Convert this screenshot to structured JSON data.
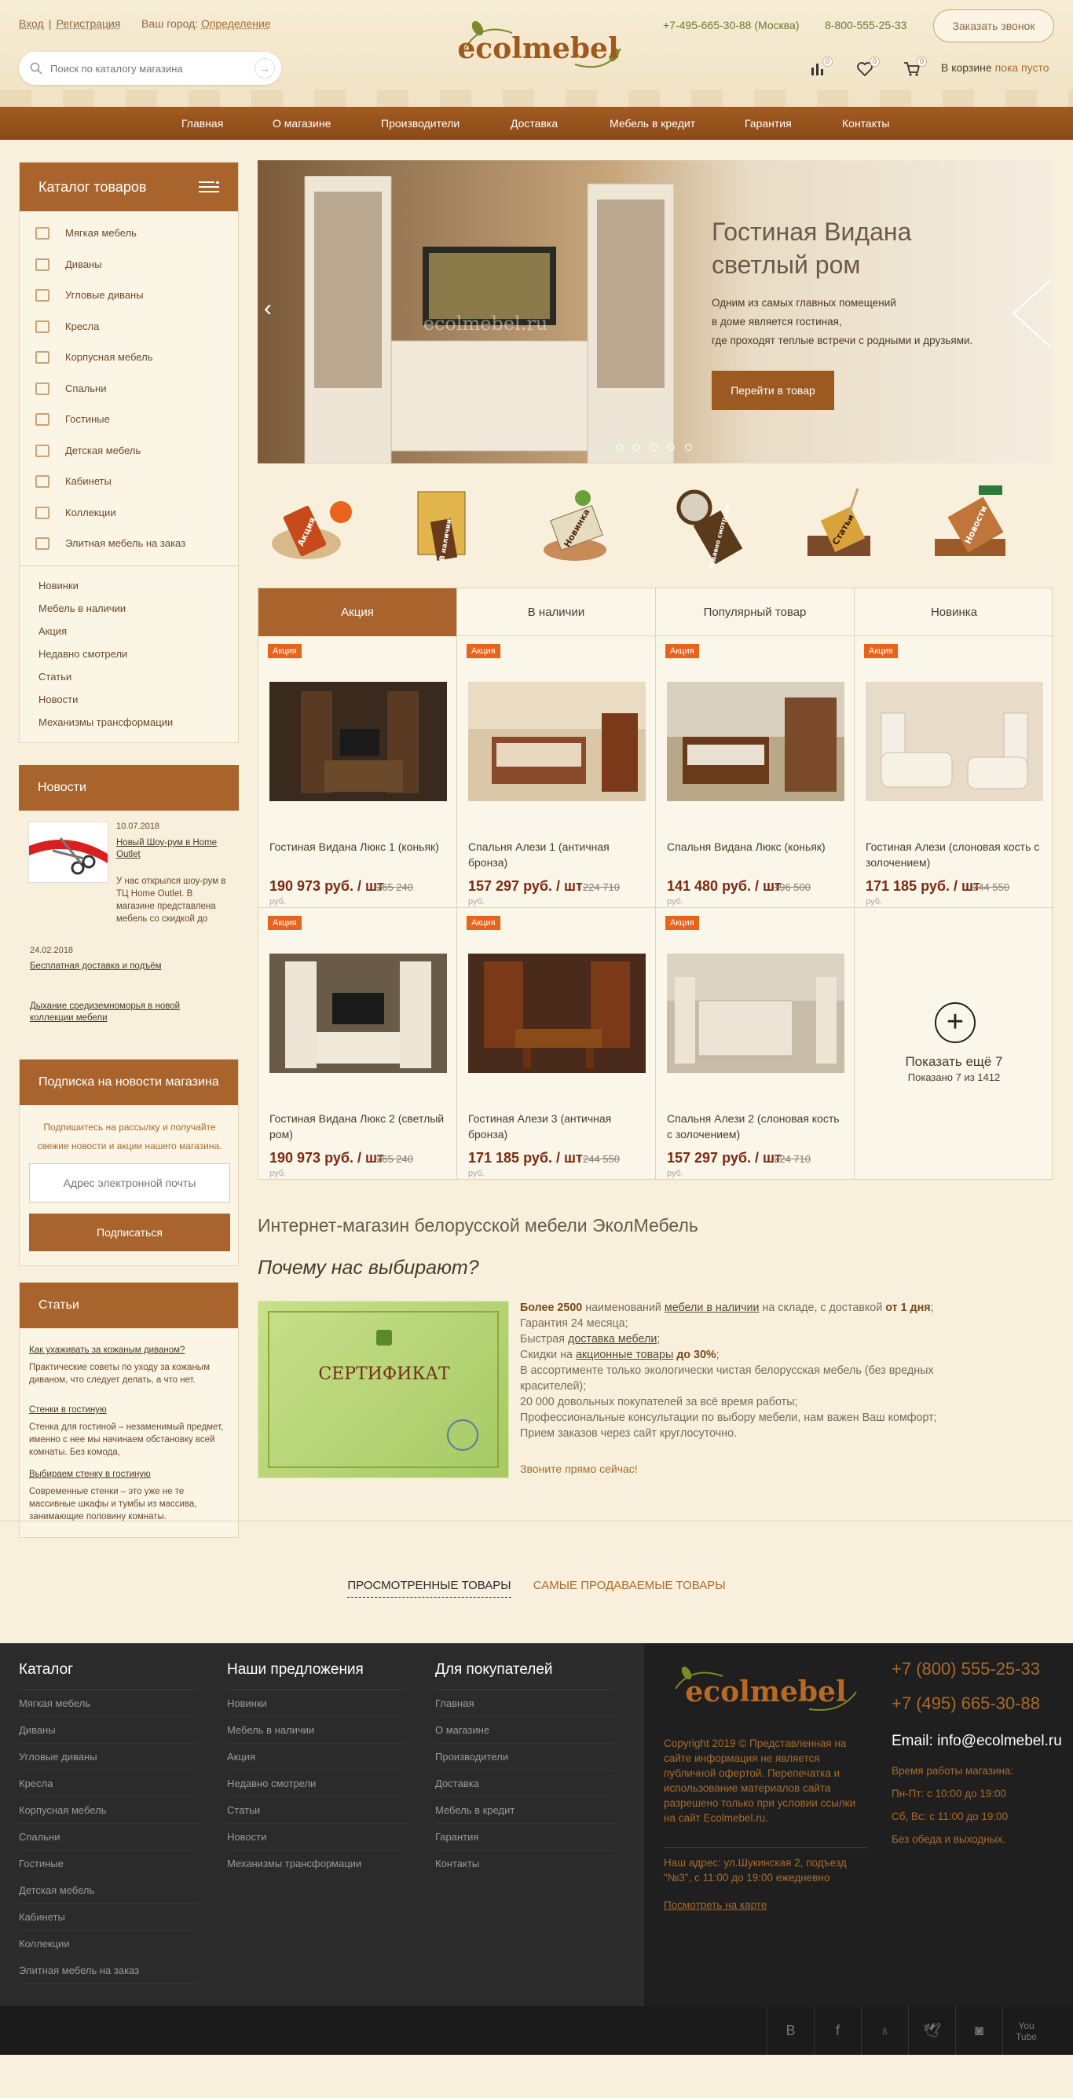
{
  "header": {
    "login": "Вход",
    "register": "Регистрация",
    "city_label": "Ваш город:",
    "city_value": "Определение",
    "search_placeholder": "Поиск по каталогу магазина",
    "logo_text": "ecolmebel",
    "phone1": "+7-495-665-30-88 (Москва)",
    "phone2": "8-800-555-25-33",
    "callback": "Заказать звонок",
    "counters": {
      "compare": "0",
      "fav": "0",
      "cart": "0"
    },
    "cart_label": "В корзине",
    "cart_status": "пока пусто"
  },
  "nav": [
    "Главная",
    "О магазине",
    "Производители",
    "Доставка",
    "Мебель в кредит",
    "Гарантия",
    "Контакты"
  ],
  "catalog": {
    "title": "Каталог товаров",
    "items": [
      "Мягкая мебель",
      "Диваны",
      "Угловые диваны",
      "Кресла",
      "Корпусная мебель",
      "Спальни",
      "Гостиные",
      "Детская мебель",
      "Кабинеты",
      "Коллекции",
      "Элитная мебель на заказ"
    ],
    "links": [
      "Новинки",
      "Мебель в наличии",
      "Акция",
      "Недавно смотрели",
      "Статьи",
      "Новости",
      "Механизмы трансформации"
    ]
  },
  "news": {
    "title": "Новости",
    "items": [
      {
        "date": "10.07.2018",
        "title": "Новый Шоу-рум в Home Outlet",
        "text": "У нас открылся шоу-рум в ТЦ Home Outlet. В магазине представлена мебель со скидкой до"
      },
      {
        "date": "24.02.2018",
        "title": "Бесплатная доставка и подъём"
      },
      {
        "title": "Дыхание средиземноморья в новой коллекции мебели"
      }
    ]
  },
  "subscribe": {
    "title": "Подписка на новости магазина",
    "text": "Подпишитесь на рассылку и получайте свежие новости и акции нашего магазина.",
    "placeholder": "Адрес электронной почты",
    "button": "Подписаться"
  },
  "articles": {
    "title": "Статьи",
    "items": [
      {
        "title": "Как ухаживать за кожаным диваном?",
        "text": "Практические советы по уходу за кожаным диваном, что следует делать, а что нет."
      },
      {
        "title": "Стенки в гостиную",
        "text": "Стенка для гостиной – незаменимый предмет, именно с нее мы начинаем обстановку всей комнаты. Без комода,"
      },
      {
        "title": "Выбираем стенку в гостиную",
        "text": "Современные стенки – это уже не те массивные шкафы и тумбы из массива, занимающие половину комнаты."
      }
    ]
  },
  "slider": {
    "title1": "Гостиная Видана",
    "title2": "светлый ром",
    "text1": "Одним из самых главных помещений",
    "text2": "в доме является гостиная,",
    "text3": "где проходят теплые встречи с родными и друзьями.",
    "button": "Перейти в товар",
    "watermark": "ecolmebel.ru"
  },
  "promos": [
    "Акция",
    "В наличии",
    "Новинка",
    "Недавно смотрели",
    "Статьи",
    "Новости"
  ],
  "tabs": [
    "Акция",
    "В наличии",
    "Популярный товар",
    "Новинка"
  ],
  "products": [
    {
      "tag": "Акция",
      "name": "Гостиная Видана Люкс 1 (коньяк)",
      "price": "190 973 руб. / шт",
      "old": "265 240",
      "rub": "руб."
    },
    {
      "tag": "Акция",
      "name": "Спальня Алези 1 (античная бронза)",
      "price": "157 297 руб. / шт",
      "old": "224 710",
      "rub": "руб."
    },
    {
      "tag": "Акция",
      "name": "Спальня Видана Люкс (коньяк)",
      "price": "141 480 руб. / шт",
      "old": "196 500",
      "rub": "руб."
    },
    {
      "tag": "Акция",
      "name": "Гостиная Алези (слоновая кость с золочением)",
      "price": "171 185 руб. / шт",
      "old": "244 550",
      "rub": "руб."
    },
    {
      "tag": "Акция",
      "name": "Гостиная Видана Люкс 2 (светлый ром)",
      "price": "190 973 руб. / шт",
      "old": "265 240",
      "rub": "руб."
    },
    {
      "tag": "Акция",
      "name": "Гостиная Алези 3 (античная бронза)",
      "price": "171 185 руб. / шт",
      "old": "244 550",
      "rub": "руб."
    },
    {
      "tag": "Акция",
      "name": "Спальня Алези 2 (слоновая кость с золочением)",
      "price": "157 297 руб. / шт",
      "old": "224 710",
      "rub": "руб."
    }
  ],
  "more": {
    "label": "Показать ещё 7",
    "count": "Показано 7 из 1412"
  },
  "intro": {
    "h1": "Интернет-магазин белорусской мебели ЭколМебель",
    "h2": "Почему нас выбирают?",
    "cert_title": "СЕРТИФИКАТ",
    "w1a": "Более 2500",
    "w1b": " наименований ",
    "w1c": "мебели в наличии",
    "w1d": " на складе, с доставкой ",
    "w1e": "от 1 дня",
    "w2": "Гарантия 24 месяца;",
    "w3a": "Быстрая ",
    "w3b": "доставка мебели",
    "w4a": "Скидки на ",
    "w4b": "акционные товары",
    "w4c": "до 30%",
    "w5": "В ассортименте только экологически чистая белорусская мебель (без вредных красителей);",
    "w6": "20 000 довольных покупателей за всё время работы;",
    "w7": "Профессиональные консультации по выбору мебели, нам важен Ваш комфорт;",
    "w8": "Прием заказов через сайт круглосуточно.",
    "call": "Звоните прямо сейчас!"
  },
  "viewed": {
    "tab1": "ПРОСМОТРЕННЫЕ ТОВАРЫ",
    "tab2": "САМЫЕ ПРОДАВАЕМЫЕ ТОВАРЫ"
  },
  "footer": {
    "col1": {
      "title": "Каталог",
      "items": [
        "Мягкая мебель",
        "Диваны",
        "Угловые диваны",
        "Кресла",
        "Корпусная мебель",
        "Спальни",
        "Гостиные",
        "Детская мебель",
        "Кабинеты",
        "Коллекции",
        "Элитная мебель на заказ"
      ]
    },
    "col2": {
      "title": "Наши предложения",
      "items": [
        "Новинки",
        "Мебель в наличии",
        "Акция",
        "Недавно смотрели",
        "Статьи",
        "Новости",
        "Механизмы трансформации"
      ]
    },
    "col3": {
      "title": "Для покупателей",
      "items": [
        "Главная",
        "О магазине",
        "Производители",
        "Доставка",
        "Мебель в кредит",
        "Гарантия",
        "Контакты"
      ]
    },
    "copyright": "Copyright 2019 © Представленная на сайте информация не является публичной офертой. Перепечатка и использование материалов сайта разрешено только при условии ссылки на сайт Ecolmebel.ru.",
    "address": "Наш адрес: ул.Шукинская 2, подъезд \"№3\", с 11:00 до 19:00 ежедневно",
    "map": "Посмотреть на карте",
    "phone1": "+7 (800) 555-25-33",
    "phone2": "+7 (495) 665-30-88",
    "email": "Email: info@ecolmebel.ru",
    "hours_title": "Время работы магазина:",
    "hours1": "Пн-Пт: с 10:00 до 19:00",
    "hours2": "Сб, Вс: с 11:00 до 19:00",
    "hours3": "Без обеда и выходных."
  },
  "social": [
    "vk-icon",
    "facebook-icon",
    "odnoklassniki-icon",
    "twitter-icon",
    "instagram-icon",
    "youtube-icon"
  ]
}
